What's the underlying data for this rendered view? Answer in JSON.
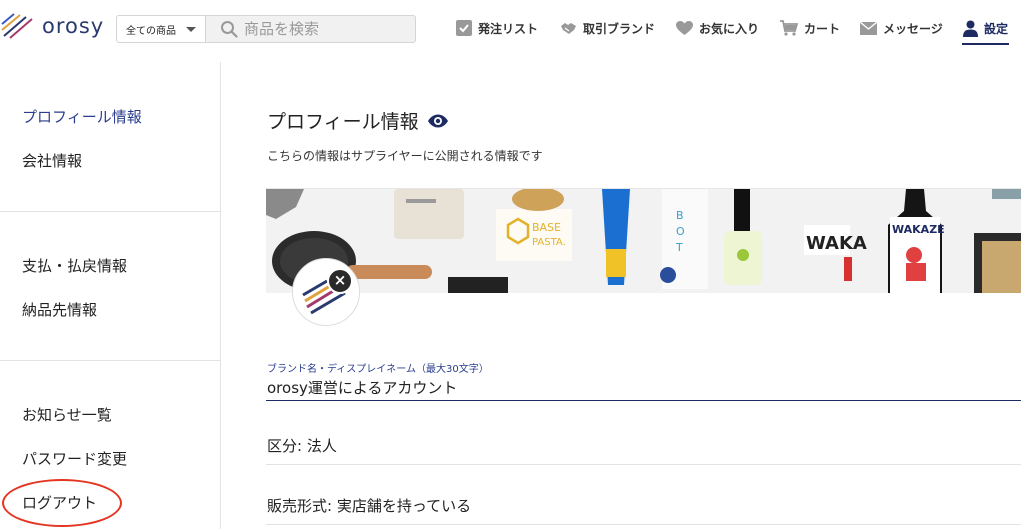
{
  "header": {
    "logo_text": "orosy",
    "category_select": "全ての商品",
    "search_placeholder": "商品を検索",
    "nav": [
      {
        "label": "発注リスト",
        "icon": "checklist-icon"
      },
      {
        "label": "取引ブランド",
        "icon": "handshake-icon"
      },
      {
        "label": "お気に入り",
        "icon": "heart-icon"
      },
      {
        "label": "カート",
        "icon": "cart-icon"
      },
      {
        "label": "メッセージ",
        "icon": "mail-icon"
      },
      {
        "label": "設定",
        "icon": "user-icon",
        "active": true
      }
    ]
  },
  "sidebar": {
    "items": [
      {
        "label": "プロフィール情報",
        "active": true
      },
      {
        "label": "会社情報"
      },
      {
        "label": "支払・払戻情報"
      },
      {
        "label": "納品先情報"
      },
      {
        "label": "お知らせ一覧"
      },
      {
        "label": "パスワード変更"
      },
      {
        "label": "ログアウト",
        "highlighted": true
      }
    ]
  },
  "main": {
    "title": "プロフィール情報",
    "subtitle": "こちらの情報はサプライヤーに公開される情報です",
    "banner": {
      "base_label": "BASE",
      "pasta_label": "PASTA.",
      "wakaze_label": "WAKAZE",
      "waka_label": "WAKA"
    },
    "avatar_close": "×",
    "brand_field": {
      "label": "ブランド名・ディスプレイネーム（最大30文字）",
      "value": "orosy運営によるアカウント"
    },
    "rows": [
      {
        "text": "区分: 法人"
      },
      {
        "text": "販売形式: 実店舗を持っている"
      }
    ]
  },
  "colors": {
    "brand_navy": "#1e2b63",
    "active_blue": "#2a3d8f",
    "annotation_red": "#e53421"
  }
}
